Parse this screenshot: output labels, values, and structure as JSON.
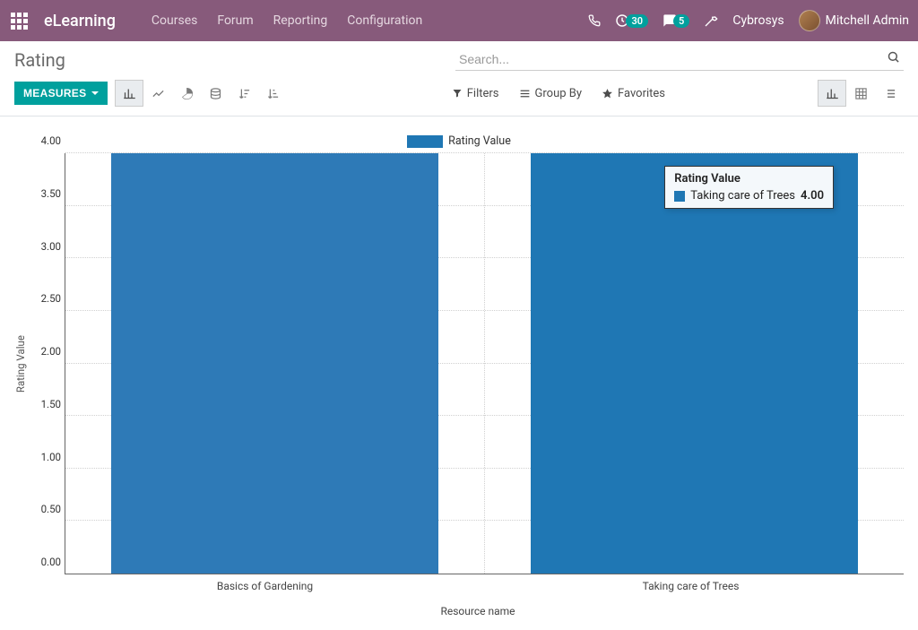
{
  "nav": {
    "brand": "eLearning",
    "menu": [
      "Courses",
      "Forum",
      "Reporting",
      "Configuration"
    ],
    "badge_activities": "30",
    "badge_messages": "5",
    "company": "Cybrosys",
    "user": "Mitchell Admin"
  },
  "page": {
    "title": "Rating"
  },
  "search": {
    "placeholder": "Search...",
    "value": ""
  },
  "toolbar": {
    "measures_label": "MEASURES",
    "filters_label": "Filters",
    "groupby_label": "Group By",
    "favorites_label": "Favorites"
  },
  "chart_data": {
    "type": "bar",
    "categories": [
      "Basics of Gardening",
      "Taking care of Trees"
    ],
    "values": [
      4.0,
      4.0
    ],
    "series_name": "Rating Value",
    "title": "",
    "xlabel": "Resource name",
    "ylabel": "Rating Value",
    "ylim": [
      0,
      4.0
    ],
    "yticks": [
      "0.00",
      "0.50",
      "1.00",
      "1.50",
      "2.00",
      "2.50",
      "3.00",
      "3.50",
      "4.00"
    ],
    "legend": {
      "label": "Rating Value"
    },
    "tooltip": {
      "title": "Rating Value",
      "category": "Taking care of Trees",
      "value": "4.00"
    },
    "colors": {
      "bar": "#2e7ab7",
      "bar_hover": "#1f77b4"
    }
  }
}
